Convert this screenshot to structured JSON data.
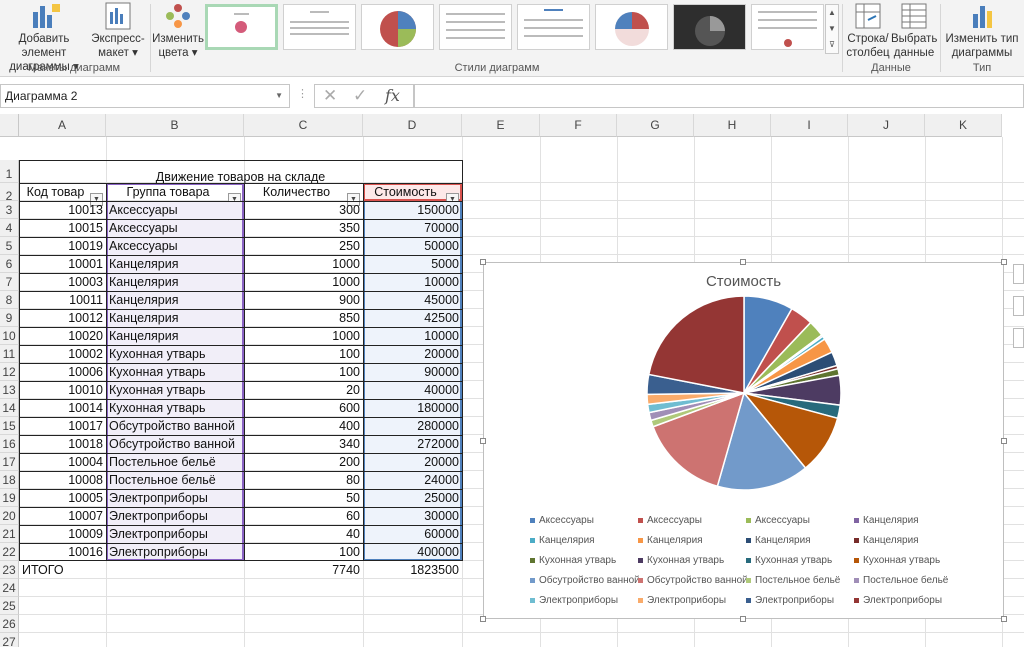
{
  "ribbon": {
    "add_element": [
      "Добавить элемент",
      "диаграммы ▾"
    ],
    "express_layout": [
      "Экспресс-",
      "макет ▾"
    ],
    "change_colors": [
      "Изменить",
      "цвета ▾"
    ],
    "row_col": [
      "Строка/",
      "столбец"
    ],
    "select_data": [
      "Выбрать",
      "данные"
    ],
    "change_type": [
      "Изменить тип",
      "диаграммы"
    ],
    "groups": {
      "layouts": "Макеты диаграмм",
      "styles": "Стили диаграмм",
      "data": "Данные",
      "type": "Тип"
    }
  },
  "formula_bar": {
    "name_box": "Диаграмма 2",
    "fx": "fx",
    "value": ""
  },
  "columns": [
    "A",
    "B",
    "C",
    "D",
    "E",
    "F",
    "G",
    "H",
    "I",
    "J",
    "K"
  ],
  "rows": [
    "1",
    "2",
    "3",
    "4",
    "5",
    "6",
    "7",
    "8",
    "9",
    "10",
    "11",
    "12",
    "13",
    "14",
    "15",
    "16",
    "17",
    "18",
    "19",
    "20",
    "21",
    "22",
    "23",
    "24",
    "25",
    "26",
    "27"
  ],
  "sheet": {
    "title": "Движение товаров на складе",
    "headers": [
      "Код товар",
      "Группа товара",
      "Количество",
      "Стоимость"
    ],
    "data": [
      [
        "10013",
        "Аксессуары",
        "300",
        "150000"
      ],
      [
        "10015",
        "Аксессуары",
        "350",
        "70000"
      ],
      [
        "10019",
        "Аксессуары",
        "250",
        "50000"
      ],
      [
        "10001",
        "Канцелярия",
        "1000",
        "5000"
      ],
      [
        "10003",
        "Канцелярия",
        "1000",
        "10000"
      ],
      [
        "10011",
        "Канцелярия",
        "900",
        "45000"
      ],
      [
        "10012",
        "Канцелярия",
        "850",
        "42500"
      ],
      [
        "10020",
        "Канцелярия",
        "1000",
        "10000"
      ],
      [
        "10002",
        "Кухонная утварь",
        "100",
        "20000"
      ],
      [
        "10006",
        "Кухонная утварь",
        "100",
        "90000"
      ],
      [
        "10010",
        "Кухонная утварь",
        "20",
        "40000"
      ],
      [
        "10014",
        "Кухонная утварь",
        "600",
        "180000"
      ],
      [
        "10017",
        "Обсутройство ванной",
        "400",
        "280000"
      ],
      [
        "10018",
        "Обсутройство ванной",
        "340",
        "272000"
      ],
      [
        "10004",
        "Постельное бельё",
        "200",
        "20000"
      ],
      [
        "10008",
        "Постельное бельё",
        "80",
        "24000"
      ],
      [
        "10005",
        "Электроприборы",
        "50",
        "25000"
      ],
      [
        "10007",
        "Электроприборы",
        "60",
        "30000"
      ],
      [
        "10009",
        "Электроприборы",
        "40",
        "60000"
      ],
      [
        "10016",
        "Электроприборы",
        "100",
        "400000"
      ]
    ],
    "total": [
      "ИТОГО",
      "7740",
      "1823500"
    ]
  },
  "chart_data": {
    "type": "pie",
    "title": "Стоимость",
    "legend_position": "bottom",
    "categories": [
      "Аксессуары",
      "Аксессуары",
      "Аксессуары",
      "Канцелярия",
      "Канцелярия",
      "Канцелярия",
      "Канцелярия",
      "Канцелярия",
      "Кухонная утварь",
      "Кухонная утварь",
      "Кухонная утварь",
      "Кухонная утварь",
      "Обсутройство ванной",
      "Обсутройство ванной",
      "Постельное бельё",
      "Постельное бельё",
      "Электроприборы",
      "Электроприборы",
      "Электроприборы",
      "Электроприборы"
    ],
    "values": [
      150000,
      70000,
      50000,
      5000,
      10000,
      45000,
      42500,
      10000,
      20000,
      90000,
      40000,
      180000,
      280000,
      272000,
      20000,
      24000,
      25000,
      30000,
      60000,
      400000
    ],
    "colors": [
      "#4f81bd",
      "#c0504d",
      "#9bbb59",
      "#8064a2",
      "#4bacc6",
      "#f79646",
      "#2c4d75",
      "#772c2a",
      "#5f7530",
      "#4d3b62",
      "#276a7c",
      "#b65708",
      "#729aca",
      "#cd7371",
      "#afc97a",
      "#a08eb7",
      "#6fbdd1",
      "#f9ab6b",
      "#3a5f8f",
      "#943634"
    ]
  }
}
